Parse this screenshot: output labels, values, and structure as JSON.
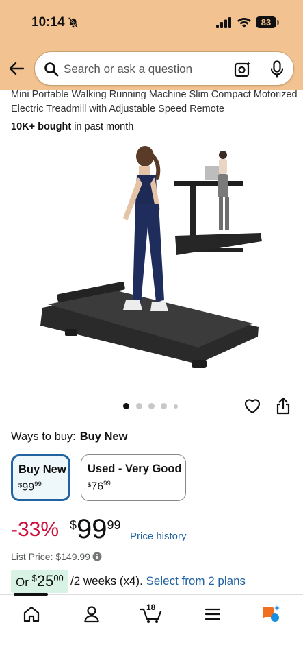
{
  "status_bar": {
    "time": "10:14",
    "battery": "83"
  },
  "search": {
    "placeholder": "Search or ask a question"
  },
  "product": {
    "title": "Mini Portable Walking Running Machine Slim Compact Motorized Electric Treadmill with Adjustable Speed Remote",
    "bought_bold": "10K+ bought",
    "bought_rest": " in past month"
  },
  "gallery": {
    "image_count": 5,
    "active_index": 0
  },
  "ways_to_buy": {
    "label": "Ways to buy:",
    "selected": "Buy New",
    "options": [
      {
        "label": "Buy New",
        "currency": "$",
        "whole": "99",
        "fraction": "99",
        "selected": true
      },
      {
        "label": "Used - Very Good",
        "currency": "$",
        "whole": "76",
        "fraction": "99",
        "selected": false
      }
    ]
  },
  "pricing": {
    "discount": "-33%",
    "currency": "$",
    "whole": "99",
    "fraction": "99",
    "price_history": "Price history",
    "list_price_label": "List Price: ",
    "list_price": "$149.99"
  },
  "installments": {
    "or": "Or ",
    "currency": "$",
    "whole": "25",
    "fraction": "00",
    "terms": "/2 weeks (x4). ",
    "link": "Select from 2 plans"
  },
  "bottom_nav": {
    "cart_count": "18"
  },
  "colors": {
    "header_bg": "#f2c290",
    "link": "#2162a1",
    "discount": "#cc0c39",
    "selected_border": "#2162a1",
    "plan_bg": "#d8f3e6"
  }
}
